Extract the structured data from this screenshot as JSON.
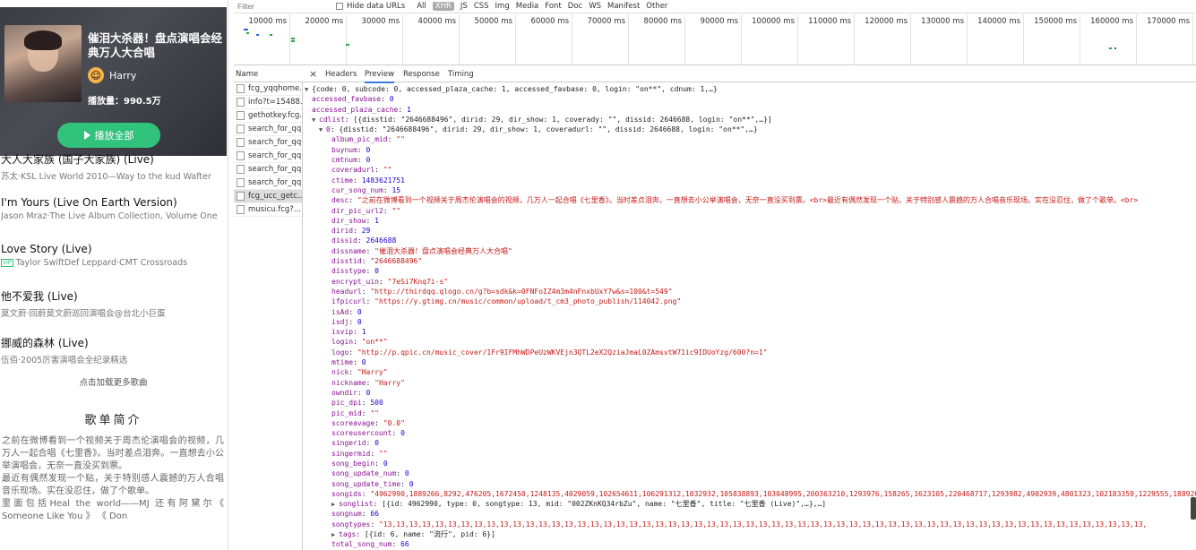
{
  "playlist": {
    "title": "催泪大杀器！盘点演唱会经典万人大合唱",
    "creator": "Harry",
    "plays": "播放量：990.5万",
    "play_all": "播放全部",
    "songs": [
      {
        "title": "大人大家族 (国子大家族) (Live)",
        "subtitle": "苏太·KSL Live World 2010—Way to the kud Wafter",
        "vip": ""
      },
      {
        "title": "I'm Yours (Live On Earth Version)",
        "subtitle": "Jason Mraz·The Live Album Collection, Volume One",
        "vip": ""
      },
      {
        "title": "Love Story (Live)",
        "subtitle": "Taylor SwiftDef Leppard·CMT Crossroads",
        "vip": "VIP"
      },
      {
        "title": "他不爱我 (Live)",
        "subtitle": "莫文蔚·回蔚莫文蔚巡回演唱会@台北小巨蛋",
        "vip": ""
      },
      {
        "title": "挪威的森林 (Live)",
        "subtitle": "伍佰·2005厉害演唱会全纪录精选",
        "vip": ""
      }
    ],
    "load_more": "点击加载更多歌曲",
    "intro_heading": "歌单简介",
    "intro_text": "之前在微博看到一个视频关于周杰伦演唱会的视频，几万人一起合唱《七里香》。当时差点泪奔。一直想去小公举演唱会，无奈一直没买到票。\n最近有偶然发现一个贴，关于特别感人震撼的万人合唱音乐现场。实在没忍住，做了个歌单。\n里面包括Heal the world——MJ 还有阿黛尔《 Someone Like You 》 《 Don"
  },
  "devtools": {
    "filter_placeholder": "Filter",
    "hide_data_urls": "Hide data URLs",
    "filter_types": [
      "All",
      "XHR",
      "JS",
      "CSS",
      "Img",
      "Media",
      "Font",
      "Doc",
      "WS",
      "Manifest",
      "Other"
    ],
    "active_filter": "XHR",
    "ticks": [
      "10000 ms",
      "20000 ms",
      "30000 ms",
      "40000 ms",
      "50000 ms",
      "60000 ms",
      "70000 ms",
      "80000 ms",
      "90000 ms",
      "100000 ms",
      "110000 ms",
      "120000 ms",
      "130000 ms",
      "140000 ms",
      "150000 ms",
      "160000 ms",
      "170000 ms"
    ],
    "name_header": "Name",
    "tabs": [
      "Headers",
      "Preview",
      "Response",
      "Timing"
    ],
    "active_tab": "Preview",
    "requests": [
      "fcg_yqqhome...",
      "info?t=15488...",
      "gethotkey.fcg...",
      "search_for_qq...",
      "search_for_qq...",
      "search_for_qq...",
      "search_for_qq...",
      "search_for_qq...",
      "fcg_ucc_getc...",
      "musicu.fcg?..."
    ],
    "selected_request": 8,
    "preview_lines": [
      "0|▼|{code: 0, subcode: 0, accessed_plaza_cache: 1, accessed_favbase: 0, login: \"on**\", cdnum: 1,…}",
      "1||accessed_favbase: 0",
      "1||accessed_plaza_cache: 1",
      "1|▼|cdlist: [{disstid: \"2646688496\", dirid: 29, dir_show: 1, coverady: \"\", dissid: 2646688, login: \"on**\",…}]",
      "2|▼|0: {disstid: \"2646688496\", dirid: 29, dir_show: 1, coveradurl: \"\", dissid: 2646688, login: \"on**\",…}",
      "3||album_pic_mid: \"\"",
      "3||buynum: 0",
      "3||cmtnum: 0",
      "3||coveradurl: \"\"",
      "3||ctime: 1483621751",
      "3||cur_song_num: 15",
      "3||desc: \"之前在微博看到一个视频关于周杰伦演唱会的视频，几万人一起合唱《七里香》。当时差点泪奔。一直想去小公举演唱会，无奈一直没买到票。<br>最近有偶然发现一个贴，关于特别感人震撼的万人合唱音乐现场。实在没忍住，做了个歌单。<br>",
      "3||dir_pic_url2: \"\"",
      "3||dir_show: 1",
      "3||dirid: 29",
      "3||dissid: 2646688",
      "3||dissname: \"催泪大杀器！盘点演唱会经典万人大合唱\"",
      "3||disstid: \"2646688496\"",
      "3||disstype: 0",
      "3||encrypt_uin: \"7eSi7Knq7i-s\"",
      "3||headurl: \"http://thirdqq.qlogo.cn/g?b=sdk&k=0FNFoIZ4m3m4nFnxbUxY7w&s=100&t=549\"",
      "3||ifpicurl: \"https://y.gtimg.cn/music/common/upload/t_cm3_photo_publish/114042.png\"",
      "3||isAd: 0",
      "3||isdj: 0",
      "3||isvip: 1",
      "3||login: \"on**\"",
      "3||logo: \"http://p.qpic.cn/music_cover/1Fr9IFMhWDPeUzWKVEjn3QTL2eX2QziaJmaL0ZAmsvtW71ic9IDUoYzg/600?n=1\"",
      "3||mtime: 0",
      "3||nick: \"Harry\"",
      "3||nickname: \"Harry\"",
      "3||owndir: 0",
      "3||pic_dpi: 500",
      "3||pic_mid: \"\"",
      "3||scoreavage: \"0.0\"",
      "3||scoreusercount: 0",
      "3||singerid: 0",
      "3||singermid: \"\"",
      "3||song_begin: 0",
      "3||song_update_num: 0",
      "3||song_update_time: 0",
      "3||songids: \"4962990,1889266,8292,476205,1672450,1248135,4029059,102654611,106291312,1032932,105838893,103048995,200363210,1293976,158265,1623105,220468717,1293982,4902939,4801323,102183359,1229555,1889263,",
      "3|▶|songlist: [{id: 4962990, type: 0, songtype: 13, mid: \"002ZKnKQ34rbZu\", name: \"七里香\", title: \"七里香 (Live)\",…},…]",
      "3||songnum: 66",
      "3||songtypes: \"13,13,13,13,13,13,13,13,13,13,13,13,13,13,13,13,13,13,13,13,13,13,13,13,13,13,13,13,13,13,13,13,13,13,13,13,13,13,13,13,13,13,13,13,13,13,13,13,13,13,13,13,13,13,13,13,13,13,13,",
      "3|▶|tags: [{id: 6, name: \"流行\", pid: 6}]",
      "3||total_song_num: 66"
    ]
  }
}
